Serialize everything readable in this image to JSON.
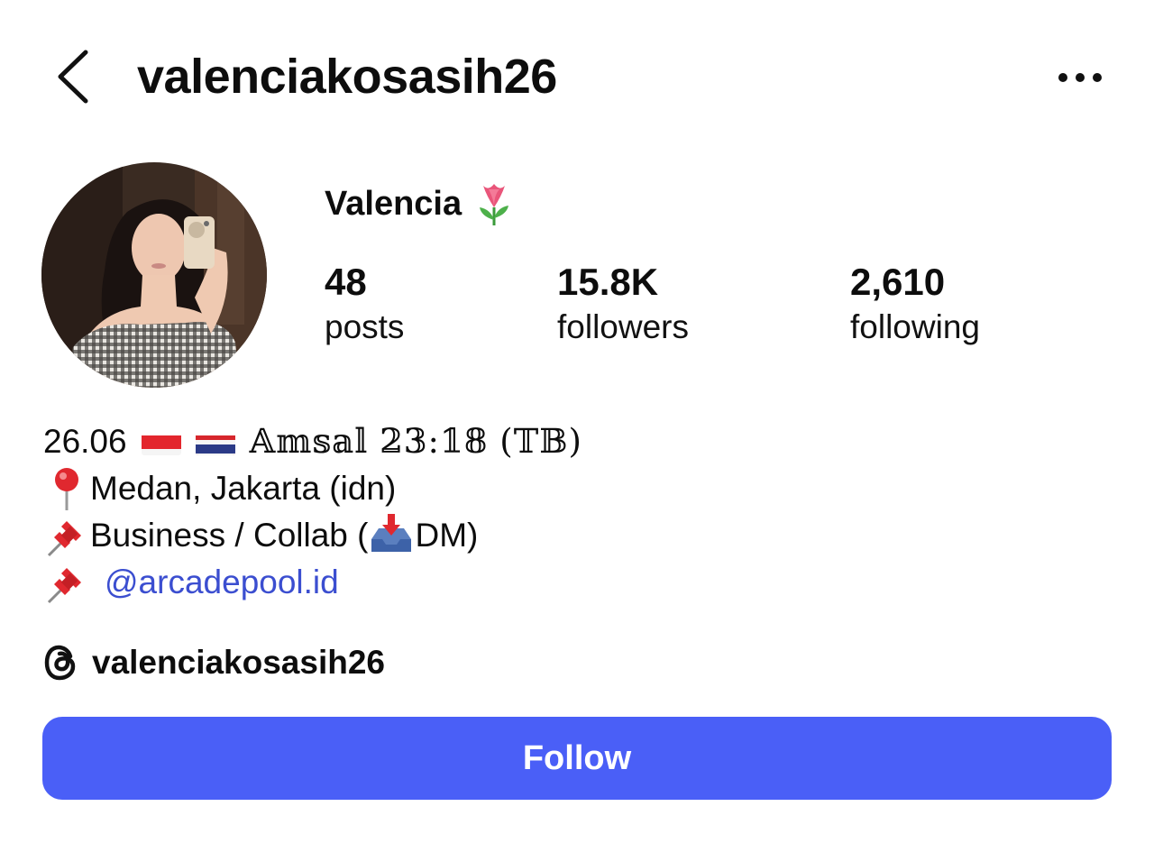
{
  "header": {
    "username": "valenciakosasih26",
    "back_icon": "chevron-left-icon",
    "more_icon": "more-horizontal-icon"
  },
  "profile": {
    "display_name": "Valencia",
    "name_emoji": "tulip-emoji",
    "stats": [
      {
        "value": "48",
        "label": "posts"
      },
      {
        "value": "15.8K",
        "label": "followers"
      },
      {
        "value": "2,610",
        "label": "following"
      }
    ]
  },
  "bio": {
    "line1_date": "26.06",
    "line1_verse": "𝔸𝕞𝕤𝕒𝕝 𝟚𝟛:𝟙𝟠 (𝕋𝔹)",
    "line1_close": ")",
    "line2_text": "Medan, Jakarta (idn)",
    "line3_text_a": "Business / Collab (",
    "line3_text_b": "DM)",
    "line4_mention": "@arcadepool.id"
  },
  "threads": {
    "icon": "threads-icon",
    "handle": "valenciakosasih26"
  },
  "actions": {
    "follow_label": "Follow",
    "follow_color": "#4a5ff7"
  }
}
